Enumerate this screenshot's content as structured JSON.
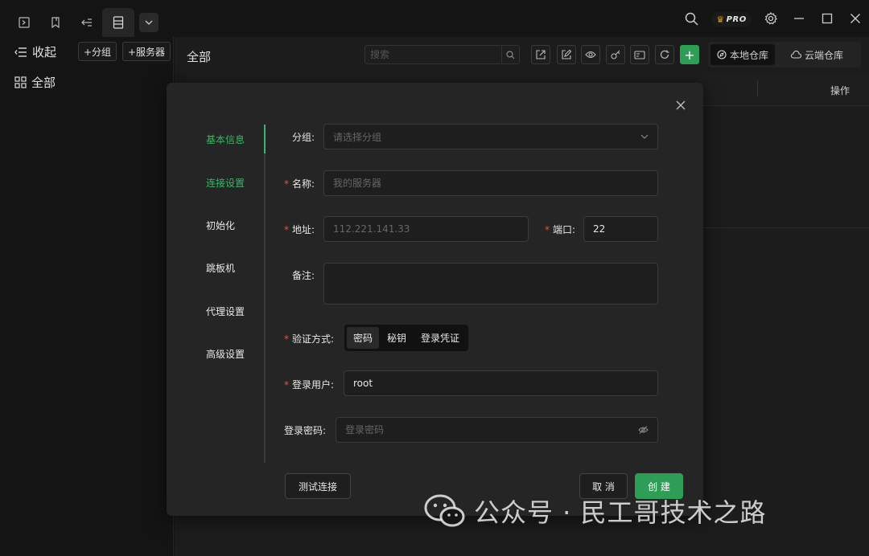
{
  "titlebar": {
    "pro_badge": "PRO",
    "icons": [
      "terminal-icon",
      "bookmark-icon",
      "transfer-icon",
      "server-list-icon",
      "chevron-down-icon",
      "search-icon",
      "settings-icon",
      "minimize-icon",
      "maximize-icon",
      "close-icon"
    ]
  },
  "sidebar": {
    "collapse_label": "收起",
    "add_group_label": "+分组",
    "add_server_label": "+服务器",
    "all_label": "全部"
  },
  "main": {
    "title": "全部",
    "search_placeholder": "搜索",
    "local_repo_label": "本地仓库",
    "cloud_repo_label": "云端仓库",
    "op_column": "操作",
    "add_symbol": "+"
  },
  "modal": {
    "steps": [
      {
        "label": "基本信息",
        "state": "done"
      },
      {
        "label": "连接设置",
        "state": "done"
      },
      {
        "label": "初始化",
        "state": "todo"
      },
      {
        "label": "跳板机",
        "state": "todo"
      },
      {
        "label": "代理设置",
        "state": "todo"
      },
      {
        "label": "高级设置",
        "state": "todo"
      }
    ],
    "group_label": "分组:",
    "group_placeholder": "请选择分组",
    "name_label": "名称:",
    "name_placeholder": "我的服务器",
    "address_label": "地址:",
    "address_placeholder": "112.221.141.33",
    "port_label": "端口:",
    "port_value": "22",
    "remark_label": "备注:",
    "auth_label": "验证方式:",
    "auth_options": [
      "密码",
      "秘钥",
      "登录凭证"
    ],
    "auth_selected": "密码",
    "user_label": "登录用户:",
    "user_value": "root",
    "password_label": "登录密码:",
    "password_placeholder": "登录密码",
    "test_button": "测试连接",
    "cancel_button": "取 消",
    "create_button": "创 建",
    "accent_color": "#3db46d",
    "required_color": "#e05050"
  },
  "watermark": {
    "text": "公众号 · 民工哥技术之路"
  }
}
